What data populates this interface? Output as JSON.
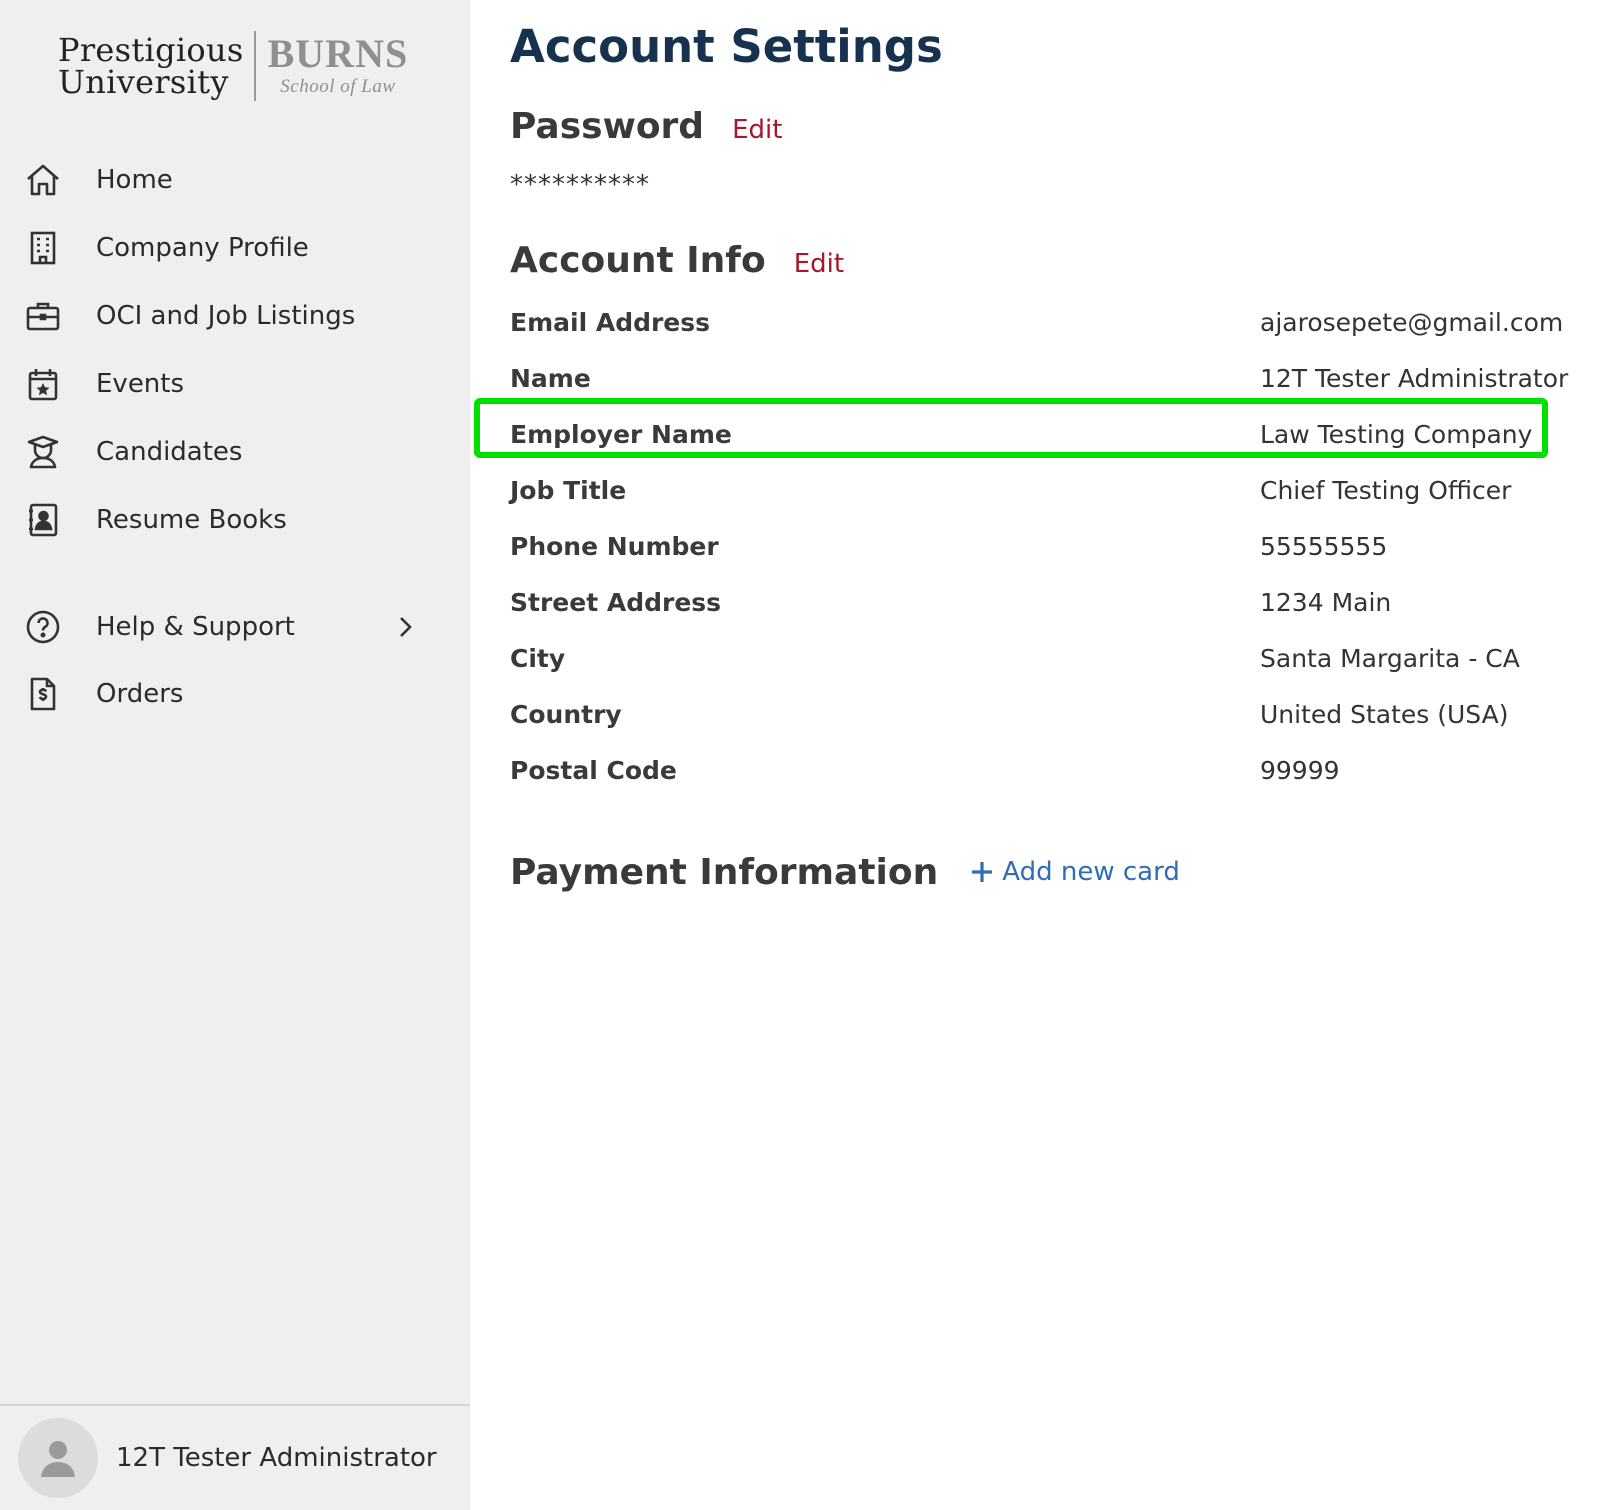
{
  "logo": {
    "university_line1": "Prestigious",
    "university_line2": "University",
    "school_name": "BURNS",
    "school_sub": "School of Law"
  },
  "sidebar": {
    "items": [
      {
        "label": "Home",
        "icon": "home-icon"
      },
      {
        "label": "Company Profile",
        "icon": "building-icon"
      },
      {
        "label": "OCI and Job Listings",
        "icon": "briefcase-icon"
      },
      {
        "label": "Events",
        "icon": "calendar-star-icon"
      },
      {
        "label": "Candidates",
        "icon": "graduate-icon"
      },
      {
        "label": "Resume Books",
        "icon": "contact-book-icon"
      },
      {
        "label": "Help & Support",
        "icon": "question-circle-icon"
      },
      {
        "label": "Orders",
        "icon": "invoice-icon"
      }
    ],
    "user_name": "12T Tester Administrator"
  },
  "main": {
    "title": "Account Settings",
    "password": {
      "heading": "Password",
      "edit_label": "Edit",
      "masked": "**********"
    },
    "account_info": {
      "heading": "Account Info",
      "edit_label": "Edit",
      "rows": [
        {
          "label": "Email Address",
          "value": "ajarosepete@gmail.com"
        },
        {
          "label": "Name",
          "value": "12T Tester Administrator"
        },
        {
          "label": "Employer Name",
          "value": "Law Testing Company"
        },
        {
          "label": "Job Title",
          "value": "Chief Testing Officer"
        },
        {
          "label": "Phone Number",
          "value": "55555555"
        },
        {
          "label": "Street Address",
          "value": "1234 Main"
        },
        {
          "label": "City",
          "value": "Santa Margarita - CA"
        },
        {
          "label": "Country",
          "value": "United States (USA)"
        },
        {
          "label": "Postal Code",
          "value": "99999"
        }
      ]
    },
    "payment": {
      "heading": "Payment Information",
      "add_card_label": "Add new card"
    }
  },
  "colors": {
    "title": "#16324f",
    "edit_link": "#a7162b",
    "add_link": "#2f6db5",
    "highlight": "#00e000",
    "sidebar_bg": "#efefef"
  }
}
